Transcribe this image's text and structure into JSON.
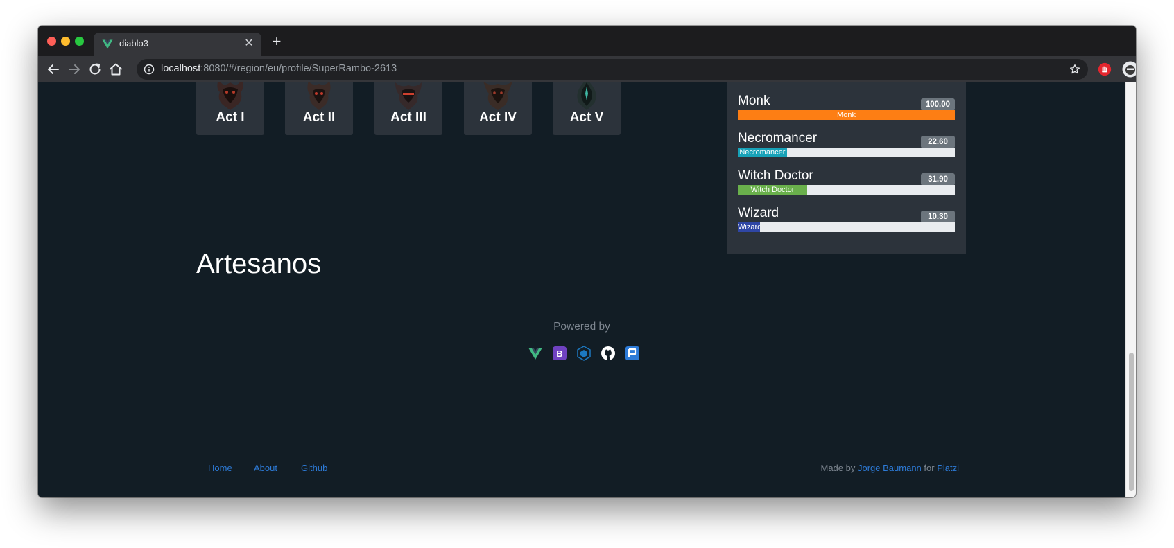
{
  "browser": {
    "tab": {
      "title": "diablo3",
      "favicon_icon": "vue-logo-icon"
    },
    "url": {
      "host": "localhost",
      "rest": ":8080/#/region/eu/profile/SuperRambo-2613"
    },
    "colors": {
      "traffic_red": "#ff5f57",
      "traffic_yellow": "#febc2e",
      "traffic_green": "#28c840"
    }
  },
  "acts": [
    {
      "label": "Act I",
      "icon": "act-1-demon-icon"
    },
    {
      "label": "Act II",
      "icon": "act-2-demon-icon"
    },
    {
      "label": "Act III",
      "icon": "act-3-demon-icon"
    },
    {
      "label": "Act IV",
      "icon": "act-4-demon-icon"
    },
    {
      "label": "Act V",
      "icon": "act-5-malthael-icon"
    }
  ],
  "classes": [
    {
      "name": "Monk",
      "value": "100.00",
      "percent": 100,
      "bar_label": "Monk",
      "color": "#fd7e14"
    },
    {
      "name": "Necromancer",
      "value": "22.60",
      "percent": 22.6,
      "bar_label": "Necromancer",
      "color": "#17a2b8"
    },
    {
      "name": "Witch Doctor",
      "value": "31.90",
      "percent": 31.9,
      "bar_label": "Witch Doctor",
      "color": "#6ab04c"
    },
    {
      "name": "Wizard",
      "value": "10.30",
      "percent": 10.3,
      "bar_label": "Wizard",
      "color": "#2f46a5"
    }
  ],
  "section": {
    "title": "Artesanos"
  },
  "powered": {
    "label": "Powered by",
    "icons": [
      "vue-icon",
      "bootstrap-icon",
      "webpack-icon",
      "github-icon",
      "platzi-icon"
    ]
  },
  "footer": {
    "links": [
      "Home",
      "About",
      "Github"
    ],
    "made_by_prefix": "Made by",
    "author": "Jorge Baumann",
    "for_word": "for",
    "org": "Platzi"
  }
}
